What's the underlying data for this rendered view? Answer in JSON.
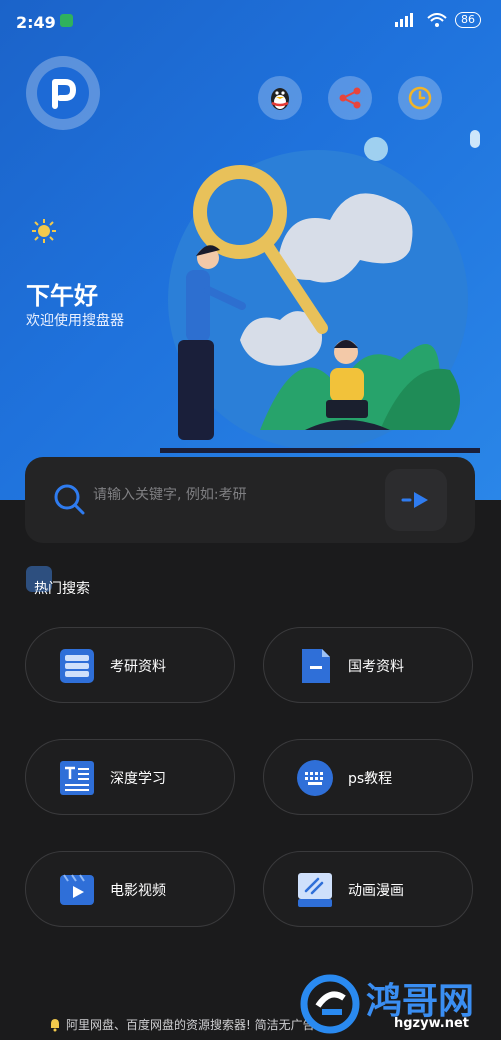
{
  "status": {
    "time": "2:49",
    "battery": "86"
  },
  "hero": {
    "greeting": "下午好",
    "subtitle": "欢迎使用搜盘器"
  },
  "search": {
    "placeholder": "请输入关键字, 例如:考研"
  },
  "hot": {
    "title": "热门搜索"
  },
  "tiles": [
    {
      "label": "考研资料",
      "icon": "database-icon"
    },
    {
      "label": "国考资料",
      "icon": "document-icon"
    },
    {
      "label": "深度学习",
      "icon": "text-doc-icon"
    },
    {
      "label": "ps教程",
      "icon": "keyboard-icon"
    },
    {
      "label": "电影视频",
      "icon": "video-icon"
    },
    {
      "label": "动画漫画",
      "icon": "drawing-icon"
    }
  ],
  "footer": {
    "text": "阿里网盘、百度网盘的资源搜索器! 简洁无广告"
  },
  "watermark": {
    "title": "鸿哥网",
    "url": "hgzyw.net"
  },
  "colors": {
    "accent": "#1f6fdc",
    "background": "#1b1b1c"
  }
}
